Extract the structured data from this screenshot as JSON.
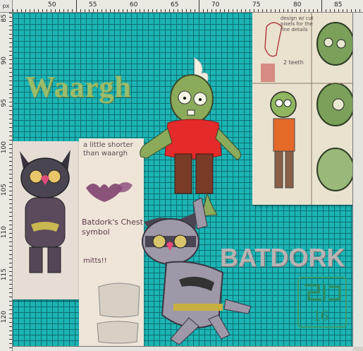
{
  "window": {
    "title": ""
  },
  "ruler": {
    "unit": "px",
    "top_labels": [
      "50",
      "55",
      "60",
      "65",
      "70",
      "75",
      "80",
      "85"
    ],
    "left_labels": [
      "85",
      "90",
      "95",
      "100",
      "105",
      "110",
      "115",
      "120"
    ]
  },
  "canvas": {
    "background_color": "#1cb4b4",
    "grid_color": "#0d6f73"
  },
  "titles": {
    "waargh": "Waargh",
    "batdork": "BATDORK"
  },
  "notes": {
    "shorter": "a little shorter than waargh",
    "chest": "Batdork's Chest symbol",
    "mitts": "mitts!!",
    "design_note": "design w/ cut pixels for the fine details",
    "teeth": "2 teeth"
  },
  "stamp": {
    "number": "16"
  },
  "icons": {
    "zombie": "zombie-character-icon",
    "cat": "batdork-cat-icon"
  }
}
